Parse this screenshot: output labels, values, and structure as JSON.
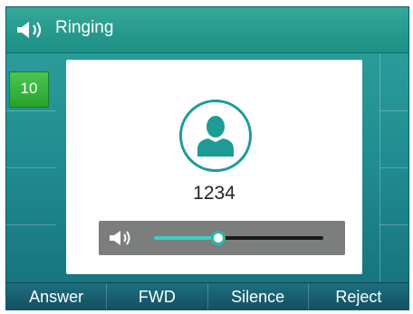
{
  "status": {
    "icon": "speaker-icon",
    "text": "Ringing"
  },
  "line_key": {
    "label": "10",
    "color": "#2fae35"
  },
  "caller": {
    "avatar_icon": "contact-avatar-icon",
    "number": "1234"
  },
  "volume": {
    "icon": "volume-icon",
    "level": 0.38
  },
  "softkeys": [
    {
      "label": "Answer"
    },
    {
      "label": "FWD"
    },
    {
      "label": "Silence"
    },
    {
      "label": "Reject"
    }
  ],
  "colors": {
    "accent": "#1e9b95",
    "background": "#1f8a8f",
    "softkey_bar": "#17596a"
  }
}
